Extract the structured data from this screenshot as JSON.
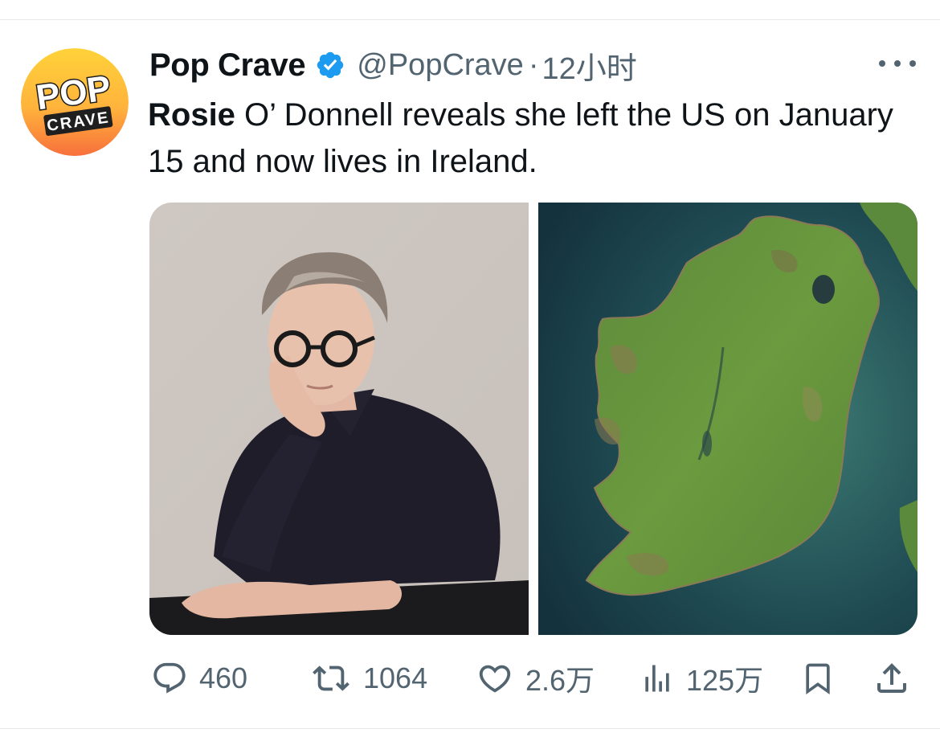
{
  "tweet": {
    "display_name": "Pop Crave",
    "handle": "@PopCrave",
    "separator": "·",
    "time": "12小时",
    "text_bold": "Rosie",
    "text_rest": " O’ Donnell reveals she left the US on January 15 and now lives in Ireland."
  },
  "avatar": {
    "line1": "POP",
    "line2": "CRAVE"
  },
  "actions": {
    "replies": "460",
    "reposts": "1064",
    "likes": "2.6万",
    "views": "125万"
  },
  "colors": {
    "text": "#0f1419",
    "secondary": "#536471",
    "verified": "#1d9bf0",
    "avatar_yellow": "#ffd23a",
    "avatar_orange": "#f7803c"
  },
  "icons": [
    "verified-badge-icon",
    "more-icon",
    "reply-icon",
    "repost-icon",
    "like-icon",
    "views-icon",
    "bookmark-icon",
    "share-icon"
  ]
}
